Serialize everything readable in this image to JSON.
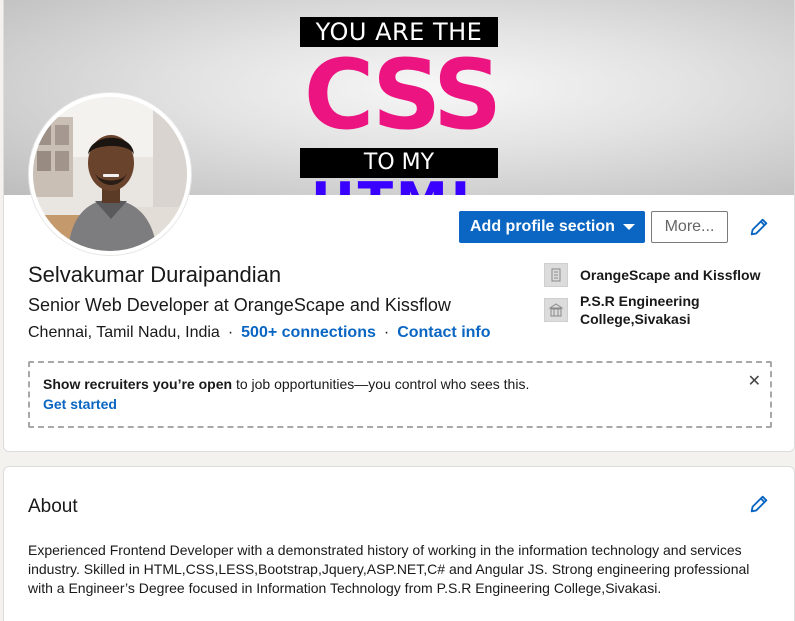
{
  "banner": {
    "line1": "YOU ARE THE",
    "line2": "CSS",
    "line3": "TO MY",
    "line4": "HTML"
  },
  "actions": {
    "add_section_label": "Add profile section",
    "more_label": "More..."
  },
  "profile": {
    "name": "Selvakumar Duraipandian",
    "headline": "Senior Web Developer at OrangeScape and Kissflow",
    "location": "Chennai, Tamil Nadu, India",
    "separator": "·",
    "connections": "500+ connections",
    "contact_info": "Contact info"
  },
  "organizations": [
    {
      "name": "OrangeScape and Kissflow",
      "icon": "company-icon"
    },
    {
      "name": "P.S.R Engineering College,Sivakasi",
      "icon": "school-icon"
    }
  ],
  "notice": {
    "bold_text": "Show recruiters you’re open",
    "text": " to job opportunities—you control who sees this.",
    "link": "Get started",
    "close": "✕"
  },
  "about": {
    "title": "About",
    "body": "Experienced Frontend Developer with a demonstrated history of working in the information technology and services industry. Skilled in HTML,CSS,LESS,Bootstrap,Jquery,ASP.NET,C# and Angular JS. Strong engineering professional with a Engineer’s Degree focused in Information Technology from P.S.R Engineering College,Sivakasi."
  },
  "colors": {
    "accent": "#0a66c2",
    "banner_pink": "#ec1480",
    "banner_blue": "#3a00ff"
  }
}
